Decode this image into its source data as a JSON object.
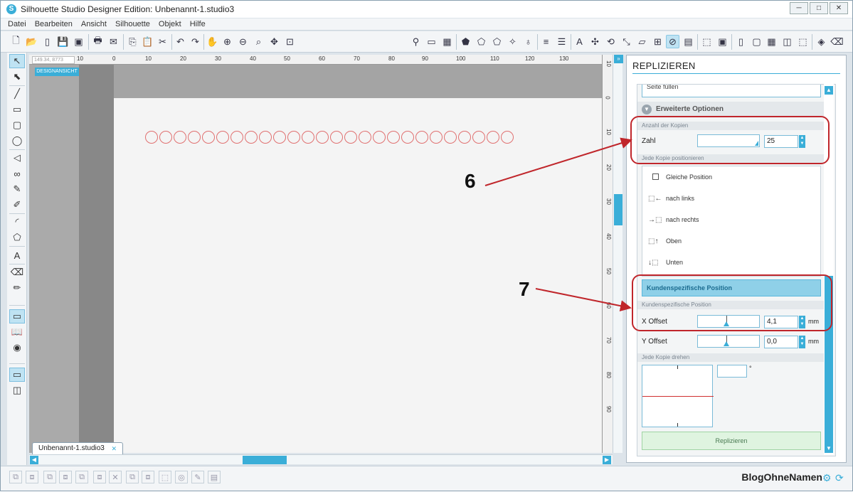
{
  "window": {
    "title": "Silhouette Studio Designer Edition: Unbenannt-1.studio3",
    "controls": [
      "─",
      "□",
      "✕"
    ]
  },
  "menu": [
    "Datei",
    "Bearbeiten",
    "Ansicht",
    "Silhouette",
    "Objekt",
    "Hilfe"
  ],
  "canvas": {
    "coord_readout": "149.34, 8773",
    "design_view_label": "DESIGNANSICHT",
    "ruler_top_labels": [
      "10",
      "0",
      "10",
      "20",
      "30",
      "40",
      "50",
      "60",
      "70",
      "80",
      "90",
      "100",
      "110",
      "120",
      "130"
    ],
    "ruler_right_labels": [
      "10",
      "0",
      "10",
      "20",
      "30",
      "40",
      "50",
      "60",
      "70",
      "80",
      "90"
    ],
    "circle_count": 26
  },
  "document_tab": {
    "label": "Unbenannt-1.studio3",
    "pin": "✕"
  },
  "panel": {
    "title": "REPLIZIEREN",
    "fill_page_label": "Seite füllen",
    "advanced_label": "Erweiterte Optionen",
    "copies_header": "Anzahl der Kopien",
    "zahl_label": "Zahl",
    "zahl_value": "25",
    "position_header": "Jede Kopie positionieren",
    "position_options": [
      "Gleiche Position",
      "nach links",
      "nach rechts",
      "Oben",
      "Unten"
    ],
    "custom_position_button": "Kundenspezifische Position",
    "custom_position_header": "Kundenspezifische Position",
    "x_offset_label": "X Offset",
    "x_offset_value": "4,1",
    "y_offset_label": "Y Offset",
    "y_offset_value": "0,0",
    "unit": "mm",
    "rotate_header": "Jede Kopie drehen",
    "degree_symbol": "°",
    "replicate_button": "Replizieren"
  },
  "annotations": {
    "callout_6": "6",
    "callout_7": "7"
  },
  "brand": {
    "name": "BlogOhneNamen"
  },
  "colors": {
    "accent": "#3aaed8",
    "annotation_red": "#c0262b",
    "circle_stroke": "#e07070"
  }
}
